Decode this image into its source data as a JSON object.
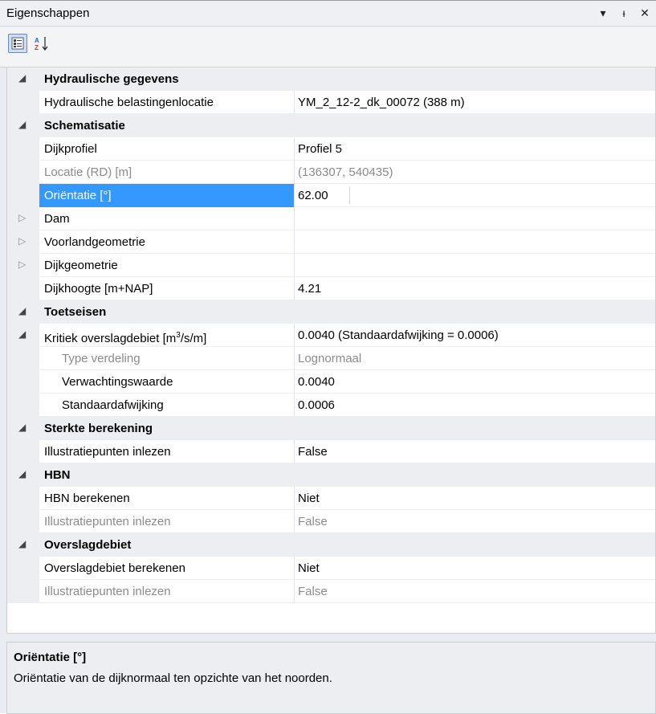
{
  "window": {
    "title": "Eigenschappen",
    "buttons": {
      "dropdown": "▾",
      "pin": "ᵻ",
      "close": "✕"
    }
  },
  "toolbar": {
    "categorized_tooltip": "Categorized",
    "alphabetical_tooltip": "Alphabetical"
  },
  "categories": [
    {
      "name": "Hydraulische gegevens",
      "properties": [
        {
          "name": "Hydraulische belastingenlocatie",
          "value": "YM_2_12-2_dk_00072 (388 m)"
        }
      ]
    },
    {
      "name": "Schematisatie",
      "properties": [
        {
          "name": "Dijkprofiel",
          "value": "Profiel 5"
        },
        {
          "name": "Locatie (RD) [m]",
          "value": "(136307, 540435)"
        },
        {
          "name": "Oriëntatie [°]",
          "value": "62.00"
        },
        {
          "name": "Dam",
          "value": ""
        },
        {
          "name": "Voorlandgeometrie",
          "value": ""
        },
        {
          "name": "Dijkgeometrie",
          "value": ""
        },
        {
          "name": "Dijkhoogte [m+NAP]",
          "value": "4.21"
        }
      ]
    },
    {
      "name": "Toetseisen",
      "properties": [
        {
          "name_prefix": "Kritiek overslagdebiet [m",
          "name_sup": "3",
          "name_suffix": "/s/m]",
          "value": "0.0040 (Standaardafwijking = 0.0006)"
        },
        {
          "name": "Type verdeling",
          "value": "Lognormaal"
        },
        {
          "name": "Verwachtingswaarde",
          "value": "0.0040"
        },
        {
          "name": "Standaardafwijking",
          "value": "0.0006"
        }
      ]
    },
    {
      "name": "Sterkte berekening",
      "properties": [
        {
          "name": "Illustratiepunten inlezen",
          "value": "False"
        }
      ]
    },
    {
      "name": "HBN",
      "properties": [
        {
          "name": "HBN berekenen",
          "value": "Niet"
        },
        {
          "name": "Illustratiepunten inlezen",
          "value": "False"
        }
      ]
    },
    {
      "name": "Overslagdebiet",
      "properties": [
        {
          "name": "Overslagdebiet berekenen",
          "value": "Niet"
        },
        {
          "name": "Illustratiepunten inlezen",
          "value": "False"
        }
      ]
    }
  ],
  "description": {
    "title": "Oriëntatie [°]",
    "text": "Oriëntatie van de dijknormaal ten opzichte van het noorden."
  },
  "colors": {
    "selection": "#3399ff",
    "category_background": "#eceef1",
    "readonly_text": "#8b8b8b"
  }
}
